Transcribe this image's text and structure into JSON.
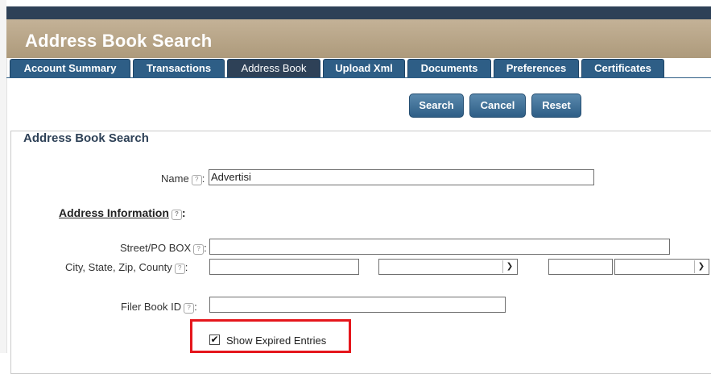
{
  "header": {
    "title": "Address Book Search"
  },
  "tabs": [
    {
      "label": "Account Summary"
    },
    {
      "label": "Transactions"
    },
    {
      "label": "Address Book"
    },
    {
      "label": "Upload Xml"
    },
    {
      "label": "Documents"
    },
    {
      "label": "Preferences"
    },
    {
      "label": "Certificates"
    }
  ],
  "actions": {
    "search": "Search",
    "cancel": "Cancel",
    "reset": "Reset"
  },
  "form": {
    "legend": "Address Book Search",
    "name": {
      "label": "Name",
      "value": "Advertisi"
    },
    "address_section": "Address Information",
    "street": {
      "label": "Street/PO BOX",
      "value": ""
    },
    "city_state_zip": {
      "label": "City, State, Zip, County",
      "city": "",
      "state": "",
      "zip": "",
      "county": ""
    },
    "filer_book_id": {
      "label": "Filer Book ID",
      "value": ""
    },
    "show_expired": {
      "label": "Show Expired Entries",
      "checked": true
    }
  },
  "colors": {
    "tab": "#2e5e86",
    "active_tab": "#2e4157",
    "highlight": "#e5161c",
    "header": "#b8a586"
  },
  "icons": {
    "help": "help-bubble-icon",
    "check": "checkmark-icon",
    "dropdown": "chevron-down-icon"
  }
}
